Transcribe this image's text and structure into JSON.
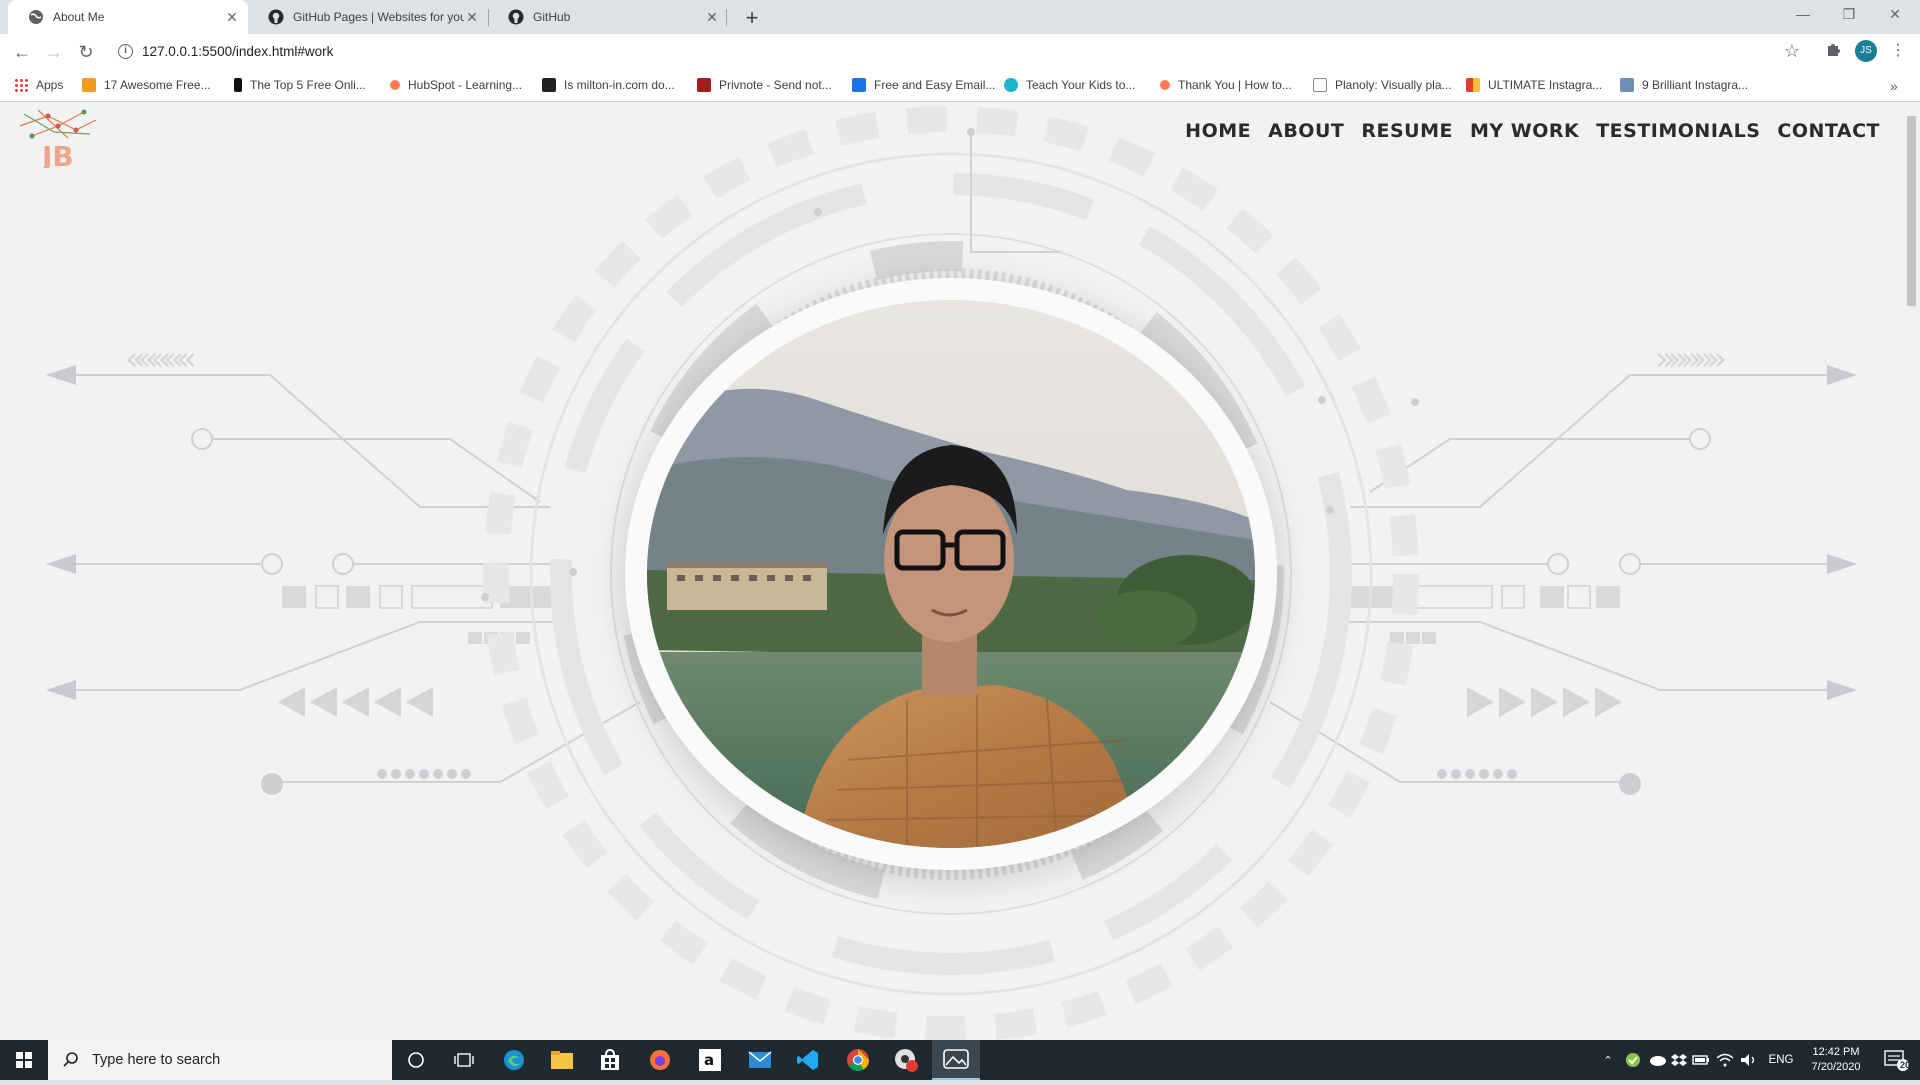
{
  "browser": {
    "tabs": [
      {
        "title": "About Me",
        "active": true
      },
      {
        "title": "GitHub Pages | Websites for you",
        "active": false
      },
      {
        "title": "GitHub",
        "active": false
      }
    ],
    "url": "127.0.0.1:5500/index.html#work",
    "profile_initials": "JS",
    "bookmarks": [
      {
        "label": "Apps",
        "icon": "apps-grid-icon",
        "color": "#e8453c"
      },
      {
        "label": "17 Awesome Free...",
        "icon": "b-icon",
        "color": "#f29c1f"
      },
      {
        "label": "The Top 5 Free Onli...",
        "icon": "i-icon",
        "color": "#111111"
      },
      {
        "label": "HubSpot - Learning...",
        "icon": "hubspot-icon",
        "color": "#ff7a59"
      },
      {
        "label": "Is milton-in.com do...",
        "icon": "m-icon",
        "color": "#222222"
      },
      {
        "label": "Privnote - Send not...",
        "icon": "privnote-icon",
        "color": "#a51d1d"
      },
      {
        "label": "Free and Easy Email...",
        "icon": "email-icon",
        "color": "#1a73e8"
      },
      {
        "label": "Teach Your Kids to...",
        "icon": "teach-icon",
        "color": "#1bb5c9"
      },
      {
        "label": "Thank You | How to...",
        "icon": "hubspot-icon",
        "color": "#ff7a59"
      },
      {
        "label": "Planoly: Visually pla...",
        "icon": "p-icon",
        "color": "#888888"
      },
      {
        "label": "ULTIMATE Instagra...",
        "icon": "ultimate-icon",
        "color": "#e53935"
      },
      {
        "label": "9 Brilliant Instagra...",
        "icon": "instagram-icon",
        "color": "#6d8fb3"
      }
    ]
  },
  "site": {
    "logo_text": "JB",
    "nav": [
      "HOME",
      "ABOUT",
      "RESUME",
      "MY WORK",
      "TESTIMONIALS",
      "CONTACT"
    ]
  },
  "taskbar": {
    "search_placeholder": "Type here to search",
    "language": "ENG",
    "time": "12:42 PM",
    "date": "7/20/2020",
    "notification_count": "20"
  }
}
